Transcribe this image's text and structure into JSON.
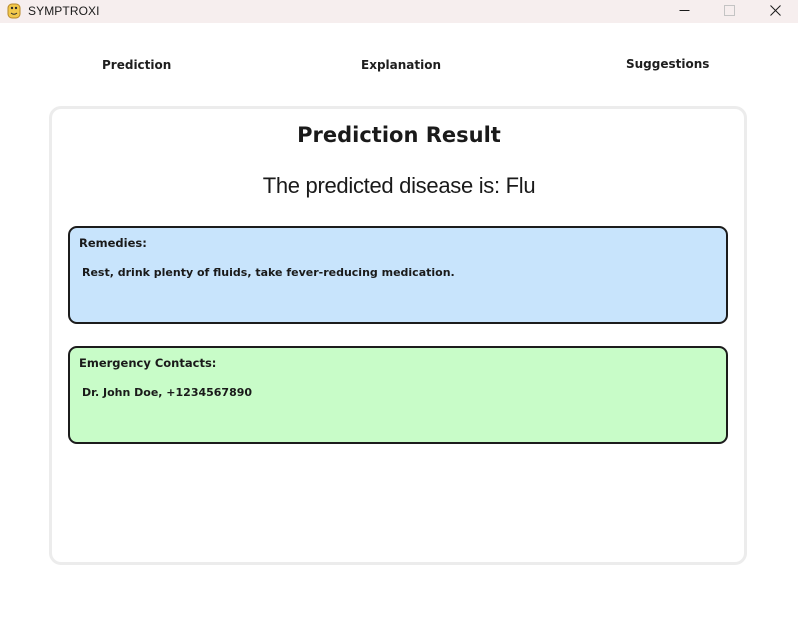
{
  "window": {
    "title": "SYMPTROXI",
    "icons": {
      "app": "python-icon",
      "minimize": "minimize-icon",
      "maximize": "maximize-icon",
      "close": "close-icon"
    }
  },
  "nav": {
    "prediction": "Prediction",
    "explanation": "Explanation",
    "suggestions": "Suggestions"
  },
  "result": {
    "title": "Prediction Result",
    "predicted_text": "The predicted disease is: Flu"
  },
  "remedies": {
    "label": "Remedies:",
    "text": "Rest, drink plenty of fluids, take fever-reducing medication.",
    "color": "#c8e4fc"
  },
  "emergency": {
    "label": "Emergency Contacts:",
    "text": "Dr. John Doe, +1234567890",
    "color": "#c8fcc8"
  }
}
